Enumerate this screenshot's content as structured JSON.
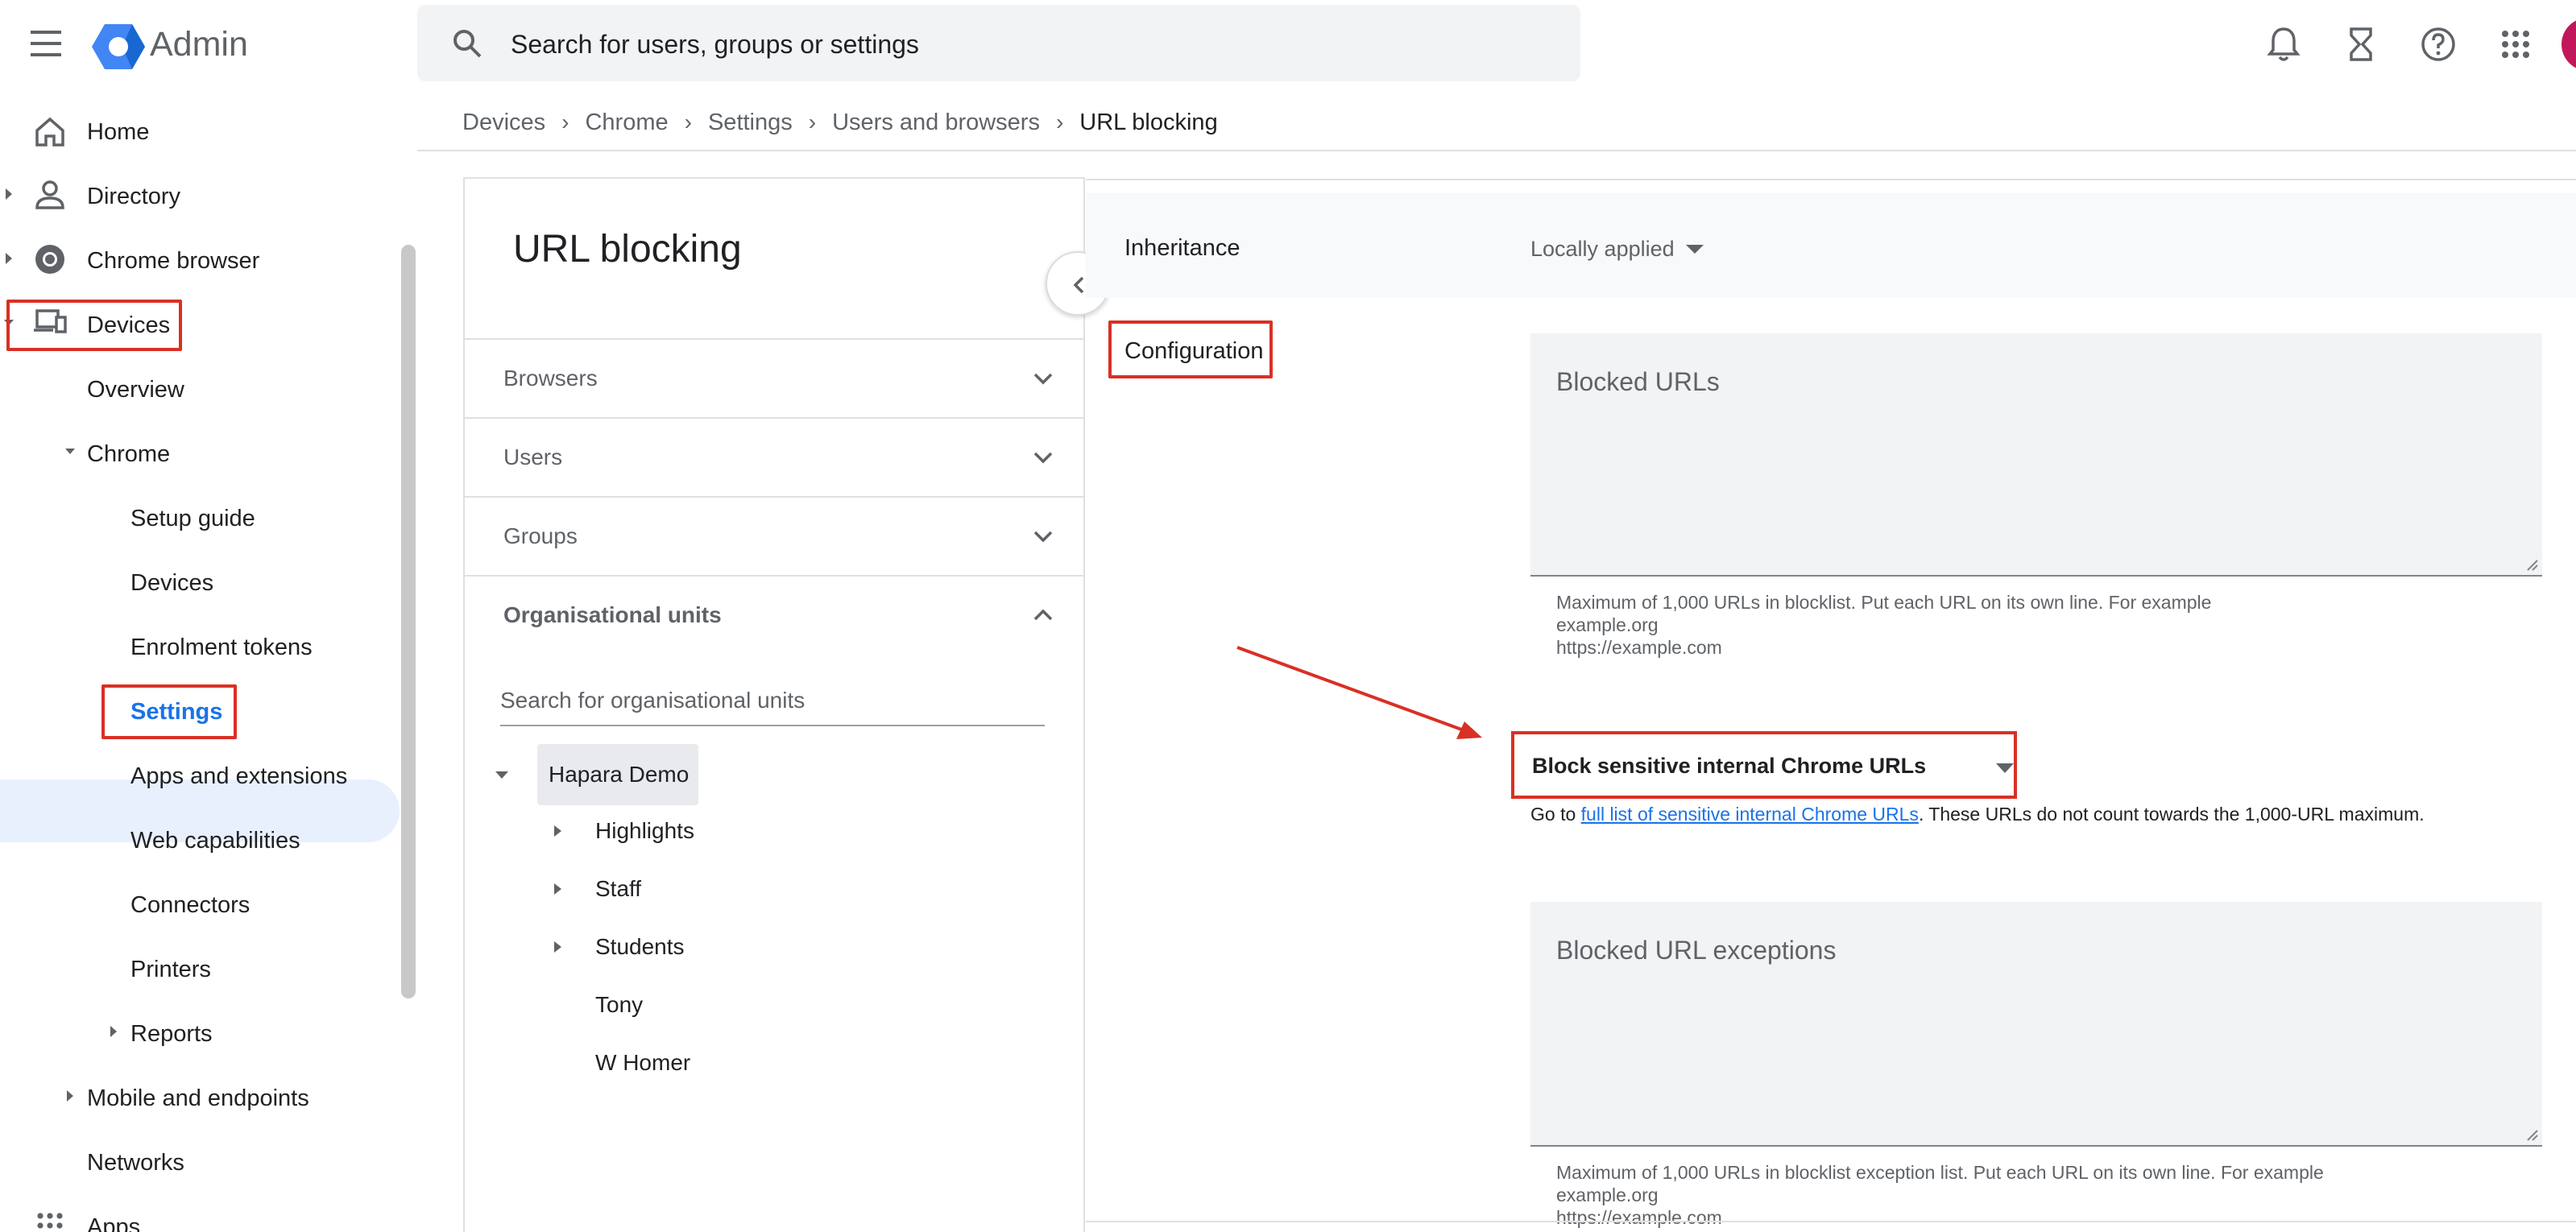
{
  "header": {
    "app_title": "Admin",
    "search_placeholder": "Search for users, groups or settings",
    "icons": [
      "menu-icon",
      "admin-logo-icon",
      "search-icon",
      "bell-icon",
      "hourglass-icon",
      "help-icon",
      "apps-grid-icon",
      "avatar"
    ],
    "avatar_color": "#c2185b"
  },
  "breadcrumb": [
    "Devices",
    "Chrome",
    "Settings",
    "Users and browsers",
    "URL blocking"
  ],
  "sidebar": {
    "items": [
      {
        "label": "Home",
        "icon": "home-icon"
      },
      {
        "label": "Directory",
        "icon": "person-icon"
      },
      {
        "label": "Chrome browser",
        "icon": "chrome-icon"
      },
      {
        "label": "Devices",
        "icon": "devices-icon"
      },
      {
        "label": "Overview"
      },
      {
        "label": "Chrome"
      },
      {
        "label": "Setup guide"
      },
      {
        "label": "Devices"
      },
      {
        "label": "Enrolment tokens"
      },
      {
        "label": "Settings",
        "selected": true
      },
      {
        "label": "Apps and extensions"
      },
      {
        "label": "Web capabilities"
      },
      {
        "label": "Connectors"
      },
      {
        "label": "Printers"
      },
      {
        "label": "Reports"
      },
      {
        "label": "Mobile and endpoints"
      },
      {
        "label": "Networks"
      },
      {
        "label": "Apps",
        "icon": "apps-grid-icon"
      }
    ]
  },
  "panel": {
    "title": "URL blocking",
    "accordions": [
      {
        "label": "Browsers",
        "expanded": false
      },
      {
        "label": "Users",
        "expanded": false
      },
      {
        "label": "Groups",
        "expanded": false
      },
      {
        "label": "Organisational units",
        "expanded": true
      }
    ],
    "ou_search_placeholder": "Search for organisational units",
    "tree": [
      {
        "label": "Hapara Demo",
        "selected": true
      },
      {
        "label": "Highlights"
      },
      {
        "label": "Staff"
      },
      {
        "label": "Students"
      },
      {
        "label": "Tony"
      },
      {
        "label": "W Homer"
      }
    ]
  },
  "settings": {
    "inheritance_label": "Inheritance",
    "inheritance_value": "Locally applied",
    "configuration_label": "Configuration",
    "blocked_urls_label": "Blocked URLs",
    "blocked_urls_help": [
      "Maximum of 1,000 URLs in blocklist. Put each URL on its own line. For example",
      "example.org",
      "https://example.com"
    ],
    "select_value": "Block sensitive internal Chrome URLs",
    "goto_prefix": "Go to ",
    "goto_link": "full list of sensitive internal Chrome URLs",
    "goto_suffix": ". These URLs do not count towards the 1,000-URL maximum.",
    "exceptions_label": "Blocked URL exceptions",
    "exceptions_help": [
      "Maximum of 1,000 URLs in blocklist exception list. Put each URL on its own line. For example",
      "example.org",
      "https://example.com"
    ]
  },
  "colors": {
    "accent": "#1a73e8",
    "highlight_red": "#d93025",
    "selected_bg": "#e8f0fe"
  }
}
